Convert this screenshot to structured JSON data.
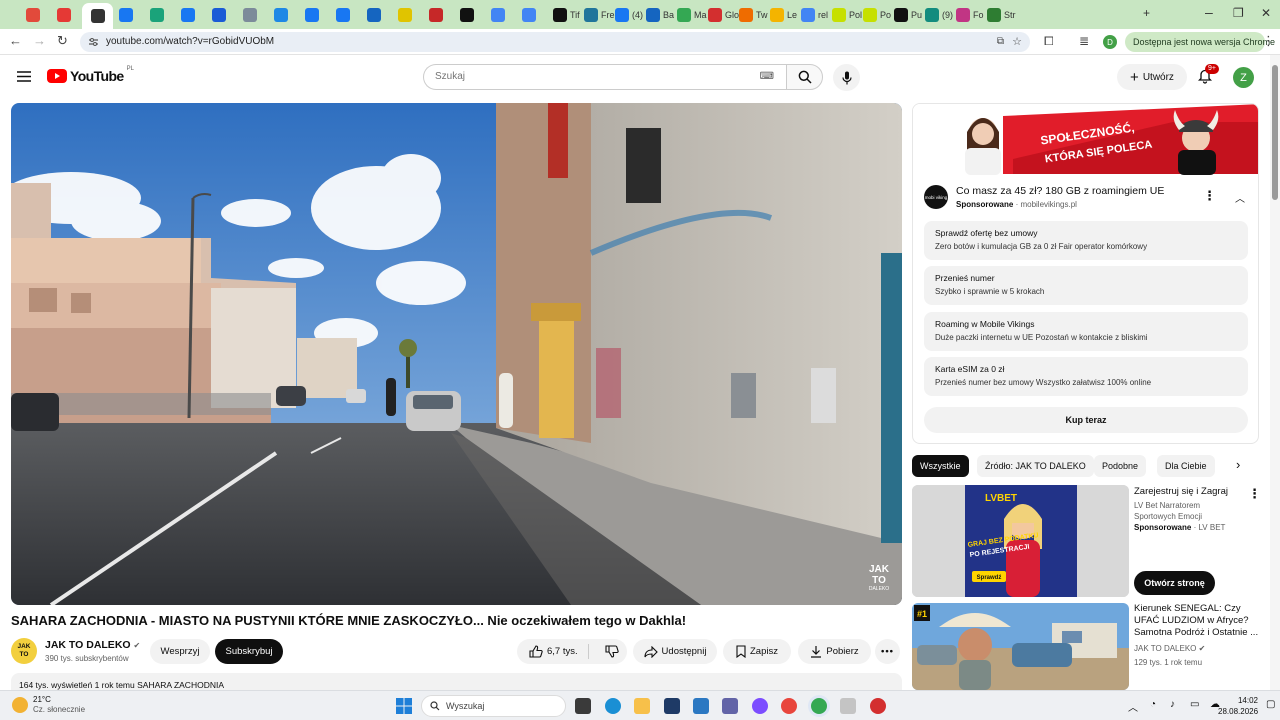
{
  "browser": {
    "tabs": [
      {
        "label": "",
        "color": "#e24a3b"
      },
      {
        "label": "",
        "color": "#e53935"
      },
      {
        "label": "",
        "color": "#333333"
      },
      {
        "label": "",
        "color": "#1877f2"
      },
      {
        "label": "",
        "color": "#1aa37a"
      },
      {
        "label": "",
        "color": "#1877f2"
      },
      {
        "label": "",
        "color": "#1a5bd6"
      },
      {
        "label": "",
        "color": "#7c8b9a"
      },
      {
        "label": "",
        "color": "#1e88e5"
      },
      {
        "label": "",
        "color": "#1877f2"
      },
      {
        "label": "",
        "color": "#1877f2"
      },
      {
        "label": "",
        "color": "#1565c0"
      },
      {
        "label": "",
        "color": "#e0c400"
      },
      {
        "label": "",
        "color": "#c62828"
      },
      {
        "label": "",
        "color": "#111111"
      },
      {
        "label": "",
        "color": "#4285f4"
      },
      {
        "label": "",
        "color": "#4285f4"
      },
      {
        "label": "Tif",
        "color": "#111111"
      },
      {
        "label": "Fre",
        "color": "#21759b"
      },
      {
        "label": "(4)",
        "color": "#1877f2"
      },
      {
        "label": "Ba",
        "color": "#1565c0"
      },
      {
        "label": "Ma",
        "color": "#34a853"
      },
      {
        "label": "Glo",
        "color": "#d32f2f"
      },
      {
        "label": "Tw",
        "color": "#ef6c00"
      },
      {
        "label": "Le",
        "color": "#f4b400"
      },
      {
        "label": "rel",
        "color": "#4285f4"
      },
      {
        "label": "Pol",
        "color": "#c6e000"
      },
      {
        "label": "Po",
        "color": "#c6e000"
      },
      {
        "label": "Pu",
        "color": "#111111"
      },
      {
        "label": "(9)",
        "color": "#128c7e"
      },
      {
        "label": "Fo",
        "color": "#c13584"
      },
      {
        "label": "Str",
        "color": "#2e7d32"
      }
    ],
    "new_tab": "+",
    "url": "youtube.com/watch?v=rGobidVUObM",
    "update_text": "Dostępna jest nowa wersja Chrome",
    "profile_initial": "D"
  },
  "yt_header": {
    "logo_text": "YouTube",
    "country": "PL",
    "search_placeholder": "Szukaj",
    "create_label": "Utwórz",
    "notif_count": "9+",
    "avatar_initial": "Z"
  },
  "video": {
    "watermark": [
      "JAK",
      "TO"
    ],
    "watermark_small": "DALEKO",
    "title": "SAHARA ZACHODNIA - MIASTO NA PUSTYNII KTÓRE MNIE ZASKOCZYŁO... Nie oczekiwałem tego w Dakhla!",
    "channel_name": "JAK TO DALEKO",
    "channel_avatar": [
      "JAK",
      "TO"
    ],
    "subscribers": "390 tys. subskrybentów",
    "support_label": "Wesprzyj",
    "subscribe_label": "Subskrybuj",
    "likes": "6,7 tys.",
    "share_label": "Udostępnij",
    "save_label": "Zapisz",
    "download_label": "Pobierz",
    "description_peek": "164 tys. wyświetleń  1 rok temu  SAHARA ZACHODNIA"
  },
  "ad": {
    "banner_text_1": "SPOŁECZNOŚĆ,",
    "banner_text_2": "KTÓRA SIĘ POLECA",
    "title": "Co masz za 45 zł? 180 GB z roamingiem UE",
    "sponsored": "Sponsorowane",
    "domain": "mobilevikings.pl",
    "logo_text": "mobi viking",
    "options": [
      {
        "title": "Sprawdź ofertę bez umowy",
        "desc": "Zero botów i kumulacja GB za 0 zł Fair operator komórkowy"
      },
      {
        "title": "Przenieś numer",
        "desc": "Szybko i sprawnie w 5 krokach"
      },
      {
        "title": "Roaming w Mobile Vikings",
        "desc": "Duże paczki internetu w UE Pozostań w kontakcie z bliskimi"
      },
      {
        "title": "Karta eSIM za 0 zł",
        "desc": "Przenieś numer bez umowy Wszystko załatwisz 100% online"
      }
    ],
    "cta": "Kup teraz"
  },
  "chips": [
    "Wszystkie",
    "Źródło: JAK TO DALEKO",
    "Podobne",
    "Dla Ciebie"
  ],
  "recommendations": [
    {
      "title": "Zarejestruj się i Zagraj",
      "subtitle_1": "LV Bet Narratorem",
      "subtitle_2": "Sportowych Emocji",
      "sponsored": "Sponsorowane",
      "advertiser": "LV BET",
      "cta": "Otwórz stronę",
      "thumb_brand": "LVBET",
      "thumb_text_1": "GRAJ BEZ PODATKU",
      "thumb_text_2": "PO REJESTRACJI",
      "thumb_button": "Sprawdź"
    },
    {
      "title": "Kierunek SENEGAL: Czy UFAĆ LUDZIOM w Afryce? Samotna Podróż i Ostatnie ...",
      "channel": "JAK TO DALEKO",
      "meta": "129 tys.  1 rok temu",
      "thumb_badge": "#1"
    }
  ],
  "taskbar": {
    "temp": "21°C",
    "weather": "Cz. słonecznie",
    "search_placeholder": "Wyszukaj",
    "time": "14:02",
    "date": "28.08.2026"
  }
}
